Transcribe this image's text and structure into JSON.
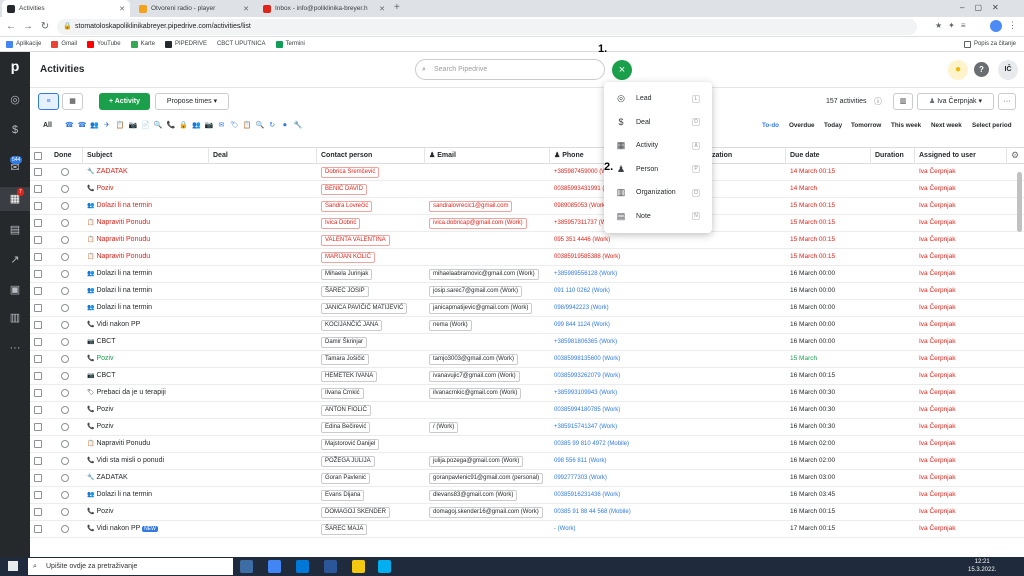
{
  "browser": {
    "tabs": [
      {
        "label": "Activities",
        "active": true
      },
      {
        "label": "Otvoreni radio - player",
        "active": false
      },
      {
        "label": "Inbox - info@poliklinika-breyer.h",
        "active": false
      }
    ],
    "url": "stomatoloskapoliklinikabreyer.pipedrive.com/activities/list",
    "bookmarks": [
      "Aplikacije",
      "Gmail",
      "YouTube",
      "Karte",
      "PIPEDRIVE",
      "CBCT UPUTNICA",
      "Termini"
    ],
    "reading_list": "Popis za čitanje"
  },
  "sidebar": {
    "mail_badge": "544",
    "activities_badge": "7"
  },
  "header": {
    "title": "Activities",
    "search_placeholder": "Search Pipedrive",
    "close_label": "×",
    "user_initials": "IČ",
    "help": "?"
  },
  "annotations": {
    "one": "1.",
    "two": "2."
  },
  "toolbar": {
    "add_activity": "+ Activity",
    "propose_times": "Propose times ▾",
    "count": "157 activities",
    "owner": "Iva Čerpnjak ▾",
    "more": "···"
  },
  "filters": {
    "all": "All",
    "periods": [
      "To-do",
      "Overdue",
      "Today",
      "Tomorrow",
      "This week",
      "Next week",
      "Select period"
    ]
  },
  "dropdown": [
    {
      "label": "Lead",
      "key": "L",
      "icon": "target-icon"
    },
    {
      "label": "Deal",
      "key": "D",
      "icon": "dollar-icon"
    },
    {
      "label": "Activity",
      "key": "A",
      "icon": "calendar-icon"
    },
    {
      "label": "Person",
      "key": "P",
      "icon": "person-icon"
    },
    {
      "label": "Organization",
      "key": "O",
      "icon": "building-icon"
    },
    {
      "label": "Note",
      "key": "N",
      "icon": "note-icon"
    }
  ],
  "table": {
    "columns": [
      "Done",
      "Subject",
      "Deal",
      "Contact person",
      "Email",
      "Phone",
      "ization",
      "Due date",
      "Duration",
      "Assigned to user"
    ],
    "rows": [
      {
        "subject": "ZADATAK",
        "icon": "🔧",
        "contact": "Dobrica Sremčević",
        "email": "",
        "phone": "+385987459000 (Work)",
        "due": "14 March 00:15",
        "user": "Iva Čerpnjak",
        "overdue": true
      },
      {
        "subject": "Poziv",
        "icon": "📞",
        "contact": "BENIĆ DAVID",
        "email": "",
        "phone": "00385993431991 (Work)",
        "due": "14 March",
        "user": "Iva Čerpnjak",
        "overdue": true
      },
      {
        "subject": "Dolazi li na termin",
        "icon": "👥",
        "contact": "Sandra Lovrečić",
        "email": "sandralovrecic1@gmail.com",
        "phone": "0989085053 (Work)",
        "due": "15 March 00:15",
        "user": "Iva Čerpnjak",
        "overdue": true
      },
      {
        "subject": "Napraviti Ponudu",
        "icon": "📋",
        "contact": "Ivica Dobrić",
        "email": "ivica.dobricap@gmail.com (Work)",
        "phone": "+385957311737 (Work)",
        "due": "15 March 00:15",
        "user": "Iva Čerpnjak",
        "overdue": true
      },
      {
        "subject": "Napraviti Ponudu",
        "icon": "📋",
        "contact": "VALENTA VALENTINA",
        "email": "",
        "phone": "095 351 4446 (Work)",
        "due": "15 March 00:15",
        "user": "Iva Čerpnjak",
        "overdue": true
      },
      {
        "subject": "Napraviti Ponudu",
        "icon": "📋",
        "contact": "MARIJAN KOLIĆ",
        "email": "",
        "phone": "00385919585388 (Work)",
        "due": "15 March 00:15",
        "user": "Iva Čerpnjak",
        "overdue": true
      },
      {
        "subject": "Dolazi li na termin",
        "icon": "👥",
        "contact": "Mihaela Jurinjak",
        "email": "mihaelaabramovic@gmail.com (Work)",
        "phone": "+385989556128 (Work)",
        "due": "16 March 00:00",
        "user": "Iva Čerpnjak",
        "overdue": false
      },
      {
        "subject": "Dolazi li na termin",
        "icon": "👥",
        "contact": "ŠAREC JOSIP",
        "email": "josip.sarec7@gmail.com (Work)",
        "phone": "091 110 0262 (Work)",
        "due": "16 March 00:00",
        "user": "Iva Čerpnjak",
        "overdue": false
      },
      {
        "subject": "Dolazi li na termin",
        "icon": "👥",
        "contact": "JANICA PAVIČIĆ MATIJEVIĆ",
        "email": "janicapmatijevic@gmail.com (Work)",
        "phone": "098/9942223 (Work)",
        "due": "16 March 00:00",
        "user": "Iva Čerpnjak",
        "overdue": false
      },
      {
        "subject": "Vidi nakon PP",
        "icon": "📞",
        "contact": "KOCIJANČIĆ JANA",
        "email": "nema (Work)",
        "phone": "099 844 1124 (Work)",
        "due": "16 March 00:00",
        "user": "Iva Čerpnjak",
        "overdue": false
      },
      {
        "subject": "CBCT",
        "icon": "📷",
        "contact": "Damir Škrinjar",
        "email": "",
        "phone": "+385981806365 (Work)",
        "due": "16 March 00:00",
        "user": "Iva Čerpnjak",
        "overdue": false
      },
      {
        "subject": "Poziv",
        "icon": "📞",
        "contact": "Tamara Jošičić",
        "email": "tamjo3003@gmail.com (Work)",
        "phone": "00385998135600 (Work)",
        "due": "15 March",
        "user": "Iva Čerpnjak",
        "overdue": false,
        "green": true
      },
      {
        "subject": "CBCT",
        "icon": "📷",
        "contact": "HEMETEK IVANA",
        "email": "ivanavujic7@gmail.com (Work)",
        "phone": "00385993262079 (Work)",
        "due": "16 March 00:15",
        "user": "Iva Čerpnjak",
        "overdue": false
      },
      {
        "subject": "Prebaci da je u terapiji",
        "icon": "🏷",
        "contact": "Ilvana Crnkić",
        "email": "ilvanacrnkic@gmail.com (Work)",
        "phone": "+385993109943 (Work)",
        "due": "16 March 00:30",
        "user": "Iva Čerpnjak",
        "overdue": false
      },
      {
        "subject": "Poziv",
        "icon": "📞",
        "contact": "ANTON FIOLIĆ",
        "email": "",
        "phone": "00385994180785 (Work)",
        "due": "16 March 00:30",
        "user": "Iva Čerpnjak",
        "overdue": false
      },
      {
        "subject": "Poziv",
        "icon": "📞",
        "contact": "Edina Bečirević",
        "email": "/ (Work)",
        "phone": "+385915741347 (Work)",
        "due": "16 March 00:30",
        "user": "Iva Čerpnjak",
        "overdue": false
      },
      {
        "subject": "Napraviti Ponudu",
        "icon": "📋",
        "contact": "Majstorović Danijel",
        "email": "",
        "phone": "00385 99 810 4972 (Mobile)",
        "due": "16 March 02:00",
        "user": "Iva Čerpnjak",
        "overdue": false
      },
      {
        "subject": "Vidi sta misli o ponudi",
        "icon": "📞",
        "contact": "POŽEGA JULIJA",
        "email": "julija.pozega@gmail.com (Work)",
        "phone": "098 556 811 (Work)",
        "due": "16 March 02:00",
        "user": "Iva Čerpnjak",
        "overdue": false
      },
      {
        "subject": "ZADATAK",
        "icon": "🔧",
        "contact": "Goran Pavlenić",
        "email": "goranpavlenic91@gmail.com (personal)",
        "phone": "0992777303 (Work)",
        "due": "16 March 03:00",
        "user": "Iva Čerpnjak",
        "overdue": false
      },
      {
        "subject": "Dolazi li na termin",
        "icon": "👥",
        "contact": "Evans Dijana",
        "email": "dlevans83@gmail.com (Work)",
        "phone": "00385916231436 (Work)",
        "due": "16 March 03:45",
        "user": "Iva Čerpnjak",
        "overdue": false
      },
      {
        "subject": "Poziv",
        "icon": "📞",
        "contact": "DOMAGOJ SKENDER",
        "email": "domagoj.skender16@gmail.com (Work)",
        "phone": "00385 91 88 44 568 (Mobile)",
        "due": "16 March 00:15",
        "user": "Iva Čerpnjak",
        "overdue": false
      },
      {
        "subject": "Vidi nakon PP",
        "icon": "📞",
        "contact": "ŠAREC MAJA",
        "email": "",
        "phone": "- (Work)",
        "due": "17 March 00:15",
        "user": "Iva Čerpnjak",
        "overdue": false,
        "new": "NEW"
      }
    ]
  },
  "taskbar": {
    "search": "Upišite ovdje za pretraživanje",
    "time": "12:21",
    "date": "15.3.2022."
  }
}
